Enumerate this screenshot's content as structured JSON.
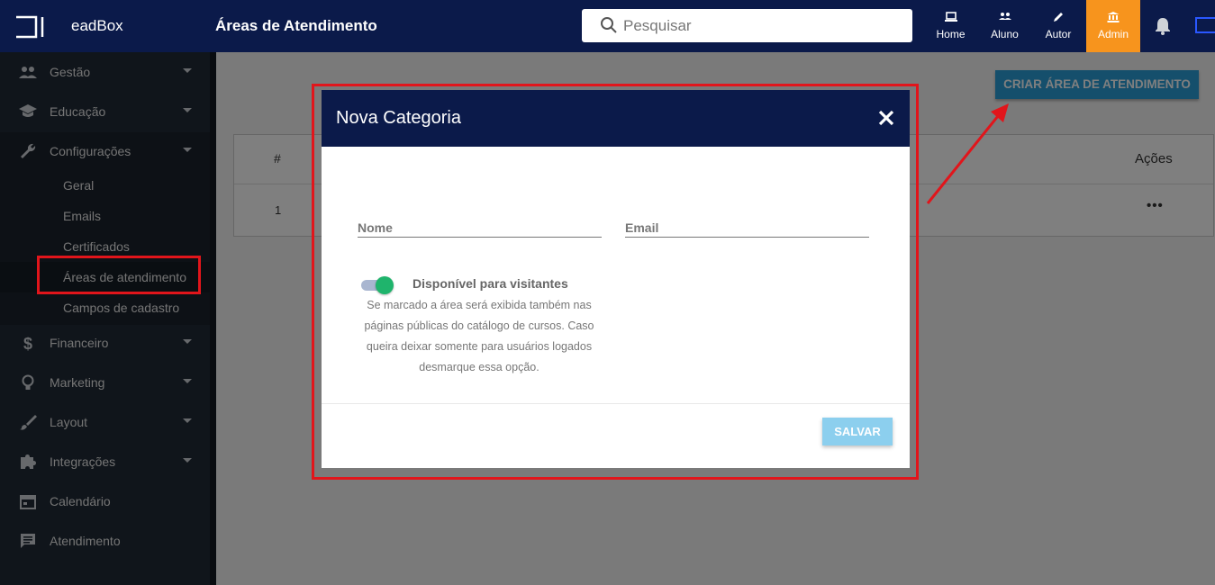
{
  "app": {
    "brand": "eadBox",
    "page_title": "Áreas de Atendimento"
  },
  "search": {
    "placeholder": "Pesquisar"
  },
  "topnav": [
    {
      "label": "Home",
      "icon": "laptop-icon"
    },
    {
      "label": "Aluno",
      "icon": "people-icon"
    },
    {
      "label": "Autor",
      "icon": "pencil-icon"
    },
    {
      "label": "Admin",
      "icon": "bank-icon",
      "active": true
    }
  ],
  "sidebar": {
    "items": [
      {
        "label": "Gestão",
        "icon": "people-icon"
      },
      {
        "label": "Educação",
        "icon": "graduation-cap-icon"
      },
      {
        "label": "Configurações",
        "icon": "wrench-icon"
      },
      {
        "label": "Financeiro",
        "icon": "dollar-icon"
      },
      {
        "label": "Marketing",
        "icon": "lightbulb-icon"
      },
      {
        "label": "Layout",
        "icon": "brush-icon"
      },
      {
        "label": "Integrações",
        "icon": "puzzle-icon"
      },
      {
        "label": "Calendário",
        "icon": "calendar-icon"
      },
      {
        "label": "Atendimento",
        "icon": "chat-icon"
      }
    ],
    "config_sub": [
      "Geral",
      "Emails",
      "Certificados",
      "Áreas de atendimento",
      "Campos de cadastro"
    ]
  },
  "main": {
    "create_button": "CRIAR ÁREA DE ATENDIMENTO",
    "table": {
      "col_hash": "#",
      "col_acoes": "Ações",
      "row_num": "1",
      "row_actions": "•••"
    }
  },
  "modal": {
    "title": "Nova Categoria",
    "nome_placeholder": "Nome",
    "email_placeholder": "Email",
    "toggle_label": "Disponível para visitantes",
    "toggle_on": true,
    "help_text": "Se marcado a área será exibida também nas páginas públicas do catálogo de cursos. Caso queira deixar somente para usuários logados desmarque essa opção.",
    "save_label": "SALVAR"
  },
  "colors": {
    "navy": "#0b1a4a",
    "admin_orange": "#f7941d",
    "annotation_red": "#e1151b",
    "toggle_green": "#1fb46c"
  }
}
